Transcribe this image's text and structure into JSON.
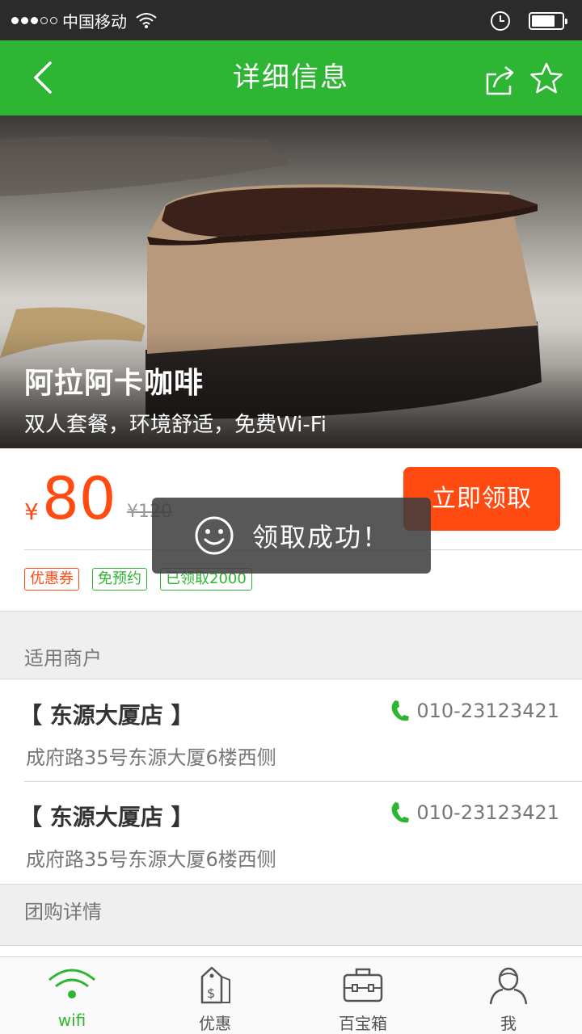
{
  "status_bar": {
    "carrier": "中国移动",
    "signal_dots": [
      true,
      true,
      true,
      false,
      false
    ]
  },
  "nav": {
    "title": "详细信息",
    "back_icon": "chevron-left-icon",
    "share_icon": "share-icon",
    "favorite_icon": "star-icon"
  },
  "hero": {
    "title": "阿拉阿卡咖啡",
    "subtitle": "双人套餐，环境舒适，免费Wi-Fi"
  },
  "deal": {
    "currency": "¥",
    "price": "80",
    "original_price": "¥120",
    "claim_label": "立即领取",
    "tags": [
      {
        "label": "优惠券",
        "color": "#ff4a12"
      },
      {
        "label": "免预约",
        "color": "#2fb534"
      },
      {
        "label": "已领取2000",
        "color": "#2fb534"
      }
    ]
  },
  "toast": {
    "icon": "smile-icon",
    "message": "领取成功！"
  },
  "merchants_section": {
    "title": "适用商户",
    "items": [
      {
        "name": "【 东源大厦店 】",
        "phone": "010-23123421",
        "address": "成府路35号东源大厦6楼西侧"
      },
      {
        "name": "【 东源大厦店 】",
        "phone": "010-23123421",
        "address": "成府路35号东源大厦6楼西侧"
      }
    ]
  },
  "details_section": {
    "title": "团购详情"
  },
  "tab_bar": {
    "active_color": "#2fb534",
    "tabs": [
      {
        "label": "wifi",
        "icon": "wifi-icon",
        "active": true
      },
      {
        "label": "优惠",
        "icon": "price-tag-icon",
        "active": false
      },
      {
        "label": "百宝箱",
        "icon": "toolbox-icon",
        "active": false
      },
      {
        "label": "我",
        "icon": "user-icon",
        "active": false
      }
    ]
  },
  "colors": {
    "brand_green": "#2fb534",
    "accent_orange": "#ff4a12",
    "status_bar": "#2b2b2b"
  }
}
